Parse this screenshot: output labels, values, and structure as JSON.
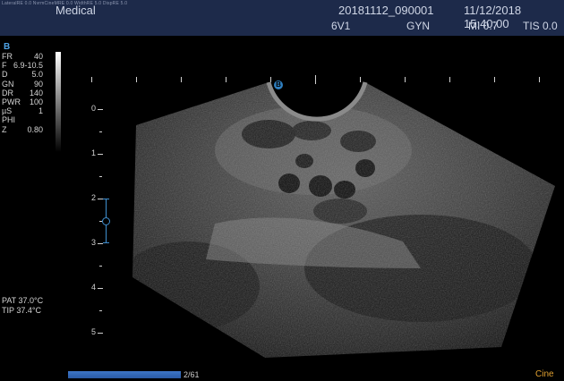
{
  "header": {
    "tiny_text": "LateralRE 0.0   NvrmCineMRE 0.0   WidthRE 5.0   DispRE 5.0",
    "institution": "Medical",
    "patient_id": "20181112_090001",
    "datetime": "11/12/2018 15:40:00",
    "probe": "6V1",
    "preset": "GYN",
    "mi": "MI 0.7",
    "tis": "TIS 0.0"
  },
  "mode": "B",
  "params": [
    {
      "label": "FR",
      "value": "40"
    },
    {
      "label": "F",
      "value": "6.9-10.5"
    },
    {
      "label": "D",
      "value": "5.0"
    },
    {
      "label": "GN",
      "value": "90"
    },
    {
      "label": "DR",
      "value": "140"
    },
    {
      "label": "PWR",
      "value": "100"
    },
    {
      "label": "µS",
      "value": "1"
    },
    {
      "label": "PHI",
      "value": ""
    },
    {
      "label": "Z",
      "value": "0.80"
    }
  ],
  "temps": {
    "pat": "PAT   37.0°C",
    "tip": "TIP   37.4°C"
  },
  "depth_labels": [
    "0",
    "1",
    "2",
    "3",
    "4",
    "5"
  ],
  "orientation_marker": "B",
  "cine": {
    "position": "2/61",
    "label": "Cine",
    "progress": 0.033
  },
  "colors": {
    "header_bg": "#1d2a4a",
    "accent_blue": "#3f8fd0",
    "cine_label": "#e0a030"
  }
}
